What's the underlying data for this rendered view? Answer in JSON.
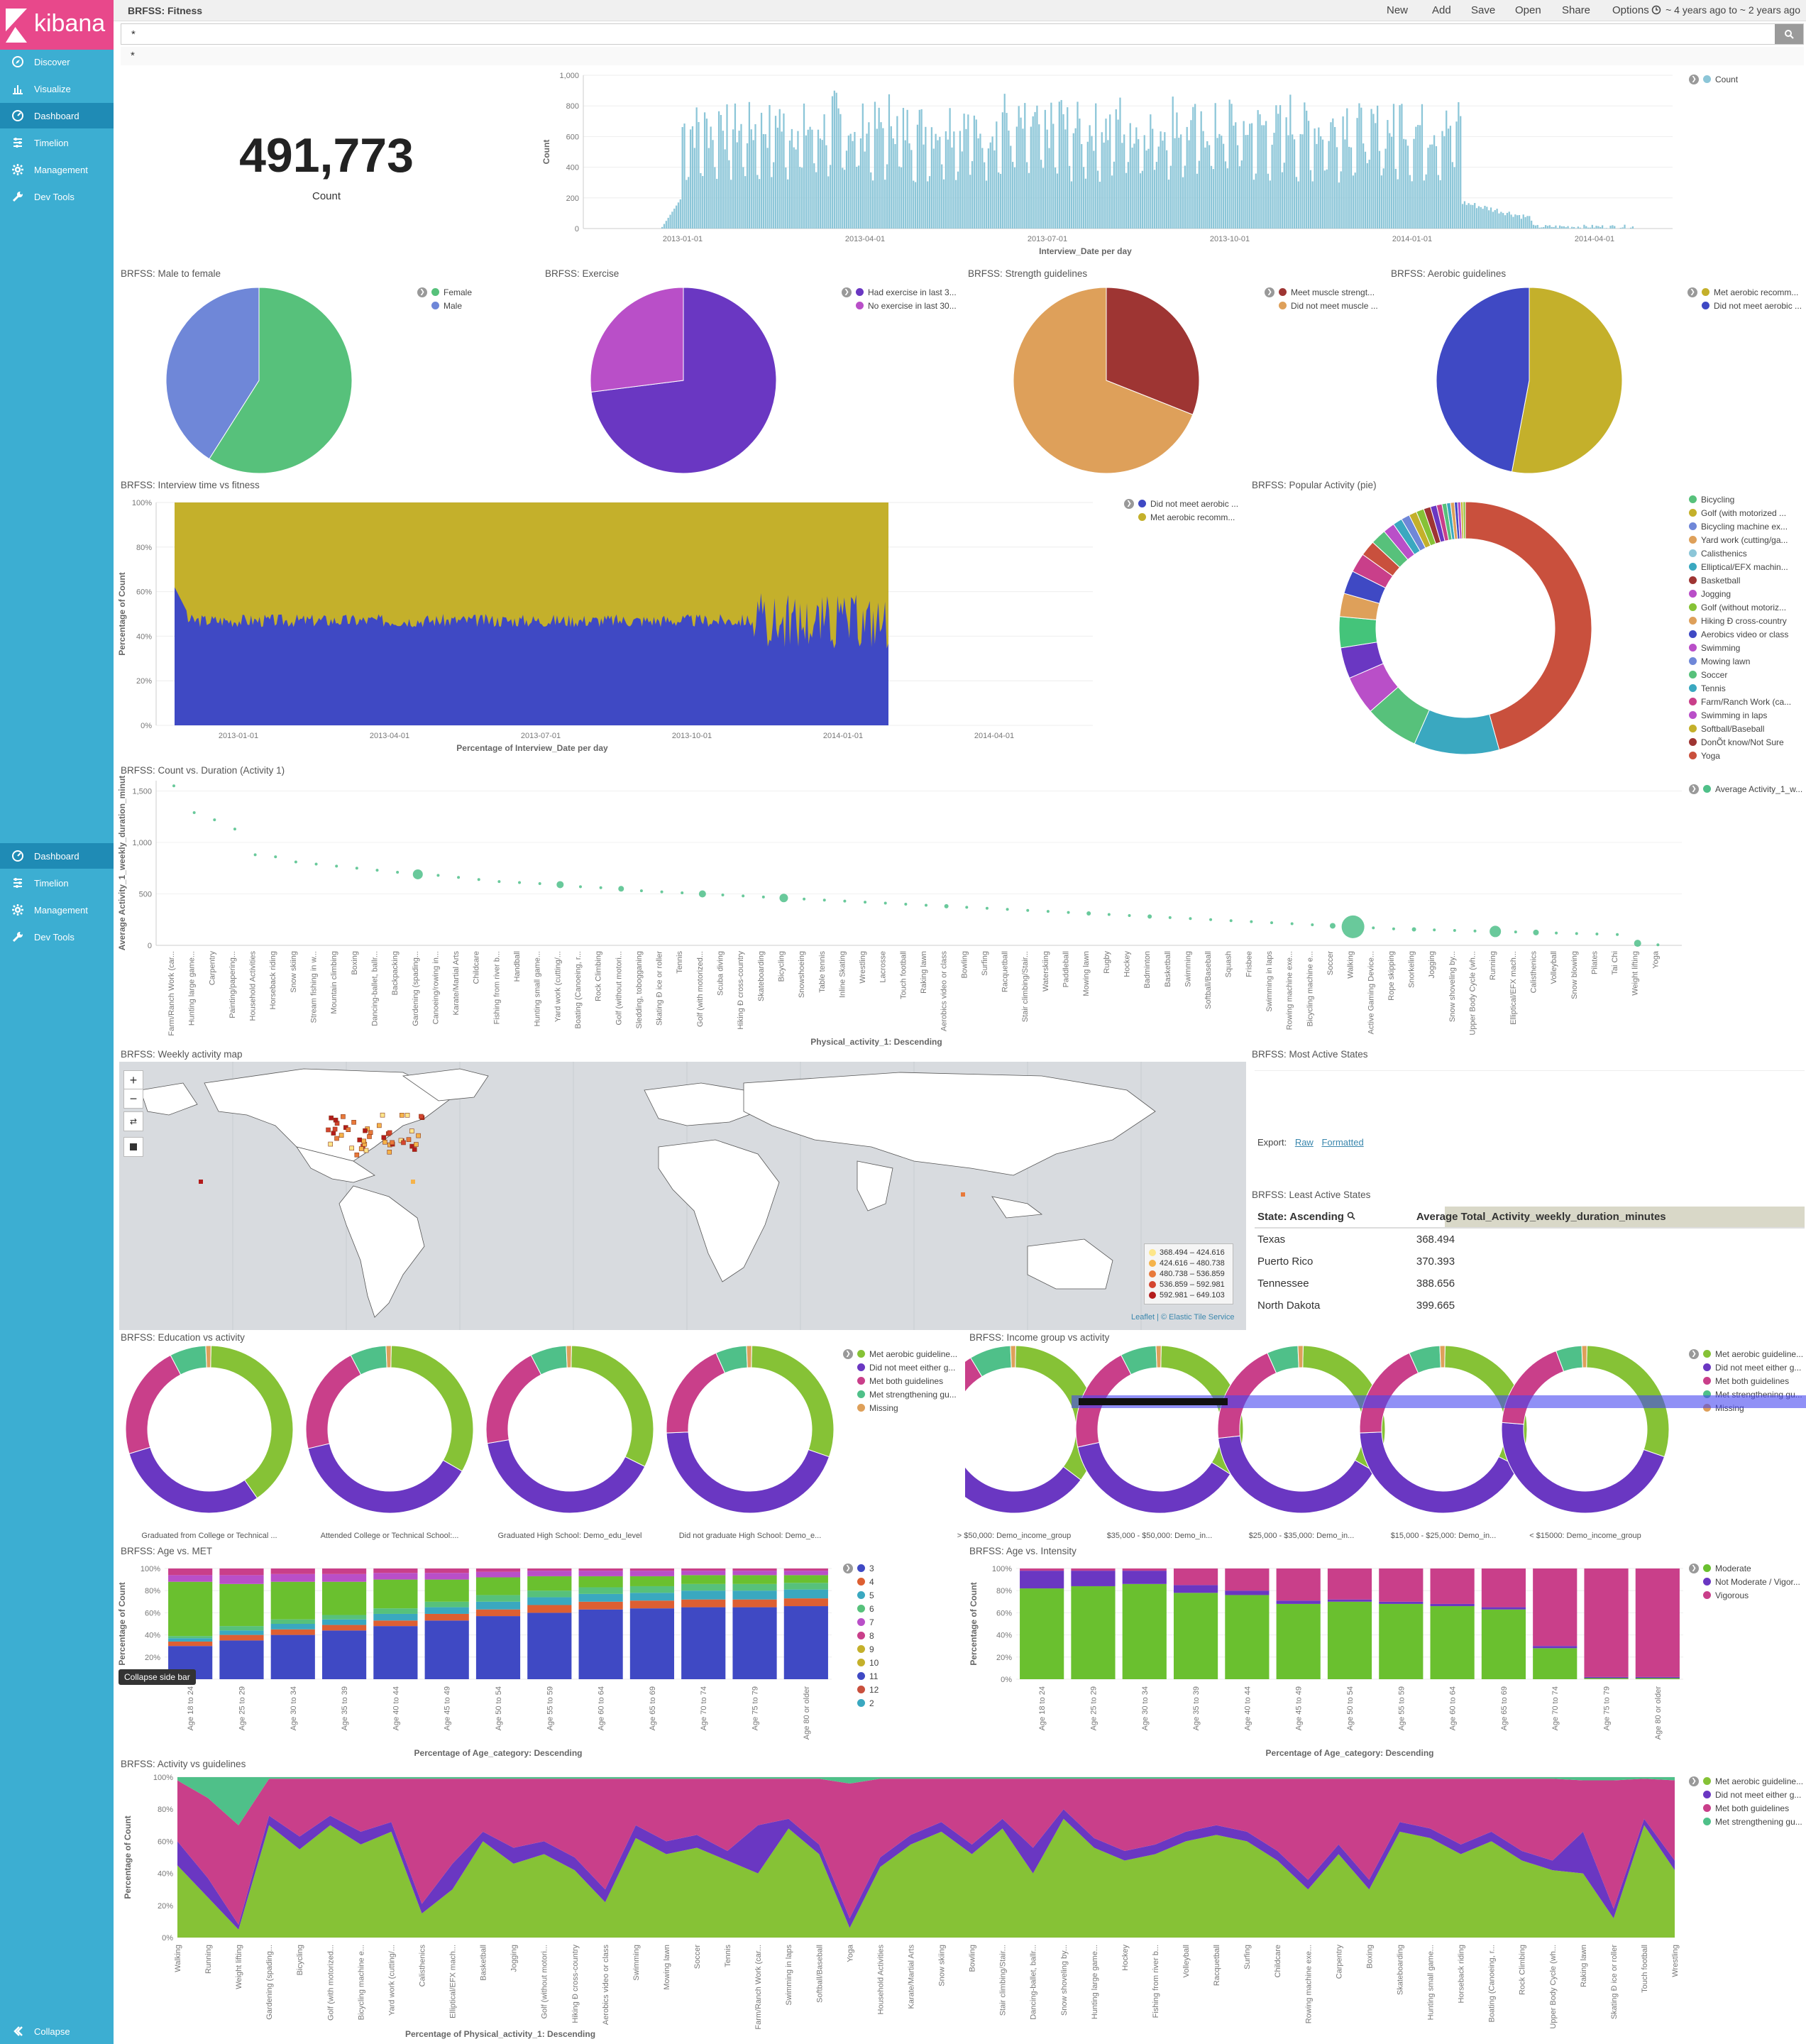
{
  "app": {
    "name": "kibana"
  },
  "nav": {
    "top": [
      {
        "label": "Discover",
        "icon": "compass-icon"
      },
      {
        "label": "Visualize",
        "icon": "bar-chart-icon"
      },
      {
        "label": "Dashboard",
        "icon": "dashboard-icon",
        "active": true
      },
      {
        "label": "Timelion",
        "icon": "timelion-icon"
      },
      {
        "label": "Management",
        "icon": "gear-icon"
      },
      {
        "label": "Dev Tools",
        "icon": "wrench-icon"
      }
    ],
    "repeat": [
      {
        "label": "Dashboard",
        "icon": "dashboard-icon",
        "active": true
      },
      {
        "label": "Timelion",
        "icon": "timelion-icon"
      },
      {
        "label": "Management",
        "icon": "gear-icon"
      },
      {
        "label": "Dev Tools",
        "icon": "wrench-icon"
      }
    ],
    "collapse": "Collapse",
    "collapse_tooltip": "Collapse side bar"
  },
  "topbar": {
    "title": "BRFSS: Fitness",
    "buttons": [
      "New",
      "Add",
      "Save",
      "Open",
      "Share",
      "Options"
    ],
    "time": "~ 4 years ago to ~ 2 years ago"
  },
  "query": {
    "value": "*",
    "filter": "*"
  },
  "metric": {
    "value": "491,773",
    "label": "Count"
  },
  "colors": {
    "teal": "#8cc6d8",
    "green": "#57c17b",
    "periwinkle": "#6f87d8",
    "purple": "#6a37c2",
    "magenta": "#b94fc8",
    "brown": "#9e3533",
    "orange": "#dea05a",
    "blue": "#3f49c4",
    "olive": "#c4b02b",
    "lime": "#86c236",
    "pink": "#c93f8a",
    "mint": "#4fc089",
    "red": "#c9503d",
    "cyan": "#3aa8c0"
  },
  "histogram": {
    "ylabel": "Count",
    "xlabel": "Interview_Date per day",
    "legend": "Count",
    "yticks": [
      "0",
      "200",
      "400",
      "600",
      "800",
      "1,000"
    ],
    "xticks": [
      "2013-01-01",
      "2013-04-01",
      "2013-07-01",
      "2013-10-01",
      "2014-01-01",
      "2014-04-01"
    ]
  },
  "pies": [
    {
      "title": "BRFSS: Male to female",
      "legend": [
        "Female",
        "Male"
      ],
      "colors": [
        "#57c17b",
        "#6f87d8"
      ],
      "values": [
        59,
        41
      ]
    },
    {
      "title": "BRFSS: Exercise",
      "legend": [
        "Had exercise in last 3...",
        "No exercise in last 30..."
      ],
      "colors": [
        "#6a37c2",
        "#b94fc8"
      ],
      "values": [
        73,
        27
      ]
    },
    {
      "title": "BRFSS: Strength guidelines",
      "legend": [
        "Meet muscle strengt...",
        "Did not meet muscle ..."
      ],
      "colors": [
        "#9e3533",
        "#dea05a"
      ],
      "values": [
        31,
        69
      ]
    },
    {
      "title": "BRFSS: Aerobic guidelines",
      "legend": [
        "Met aerobic recomm...",
        "Did not meet aerobic ..."
      ],
      "colors": [
        "#c4b02b",
        "#3f49c4"
      ],
      "values": [
        53,
        47
      ]
    }
  ],
  "interview": {
    "title": "BRFSS: Interview time vs fitness",
    "legend": [
      "Did not meet aerobic ...",
      "Met aerobic recomm..."
    ],
    "ylabel": "Percentage of Count",
    "xlabel": "Percentage of Interview_Date per day",
    "yticks": [
      "0%",
      "20%",
      "40%",
      "60%",
      "80%",
      "100%"
    ],
    "xticks": [
      "2013-01-01",
      "2013-04-01",
      "2013-07-01",
      "2013-10-01",
      "2014-01-01",
      "2014-04-01"
    ]
  },
  "popular": {
    "title": "BRFSS: Popular Activity (pie)",
    "legend": [
      "Bicycling",
      "Golf (with motorized ...",
      "Bicycling machine ex...",
      "Yard work (cutting/ga...",
      "Calisthenics",
      "Elliptical/EFX machin...",
      "Basketball",
      "Jogging",
      "Golf (without motoriz...",
      "Hiking Ð cross-country",
      "Aerobics video or class",
      "Swimming",
      "Mowing lawn",
      "Soccer",
      "Tennis",
      "Farm/Ranch Work (ca...",
      "Swimming in laps",
      "Softball/Baseball",
      "DonÕt know/Not Sure",
      "Yoga"
    ],
    "legend_colors": [
      "#57c17b",
      "#c4b02b",
      "#6f87d8",
      "#dea05a",
      "#8cc6d8",
      "#3aa8c0",
      "#9e3533",
      "#b94fc8",
      "#86c236",
      "#dea05a",
      "#3f49c4",
      "#b94fc8",
      "#6f87d8",
      "#57c17b",
      "#3aa8c0",
      "#c93f8a",
      "#b94fc8",
      "#c4b02b",
      "#9e3533",
      "#c9503d"
    ],
    "values": [
      46,
      11,
      7,
      5,
      4,
      4,
      3,
      3,
      2.5,
      2,
      2,
      1.5,
      1.2,
      1.1,
      1,
      1,
      0.9,
      0.8,
      0.7,
      0.6,
      0.5,
      0.5,
      0.4,
      0.4,
      0.3,
      0.3
    ],
    "colors": [
      "#c9503d",
      "#3aa8c0",
      "#57c17b",
      "#b94fc8",
      "#6a37c2",
      "#44c47a",
      "#dea05a",
      "#3f49c4",
      "#c93f8a",
      "#c9503d",
      "#57c17b",
      "#b94fc8",
      "#3aa8c0",
      "#6f87d8",
      "#c4b02b",
      "#86c236",
      "#9e3533",
      "#6a37c2",
      "#c93f8a",
      "#57c17b",
      "#3aa8c0",
      "#dea05a",
      "#3f49c4",
      "#b94fc8",
      "#c4b02b",
      "#86c236"
    ]
  },
  "scatter": {
    "title": "BRFSS: Count vs. Duration (Activity 1)",
    "legend": "Average Activity_1_w...",
    "ylabel": "Average Activity_1_weekly_duration_minut",
    "xlabel": "Physical_activity_1: Descending",
    "yticks": [
      "0",
      "500",
      "1,000",
      "1,500"
    ],
    "categories": [
      "Farm/Ranch Work (car...",
      "Hunting large game...",
      "Carpentry",
      "Painting/papering...",
      "Household Activities",
      "Horseback riding",
      "Snow skiing",
      "Stream fishing in w...",
      "Mountain climbing",
      "Boxing",
      "Dancing-ballet, ballr...",
      "Backpacking",
      "Gardening (spading...",
      "Canoeing/rowing in...",
      "Karate/Martial Arts",
      "Childcare",
      "Fishing from river b...",
      "Handball",
      "Hunting small game...",
      "Yard work (cutting/...",
      "Boating (Canoeing, r...",
      "Rock Climbing",
      "Golf (without motori...",
      "Sledding, tobogganing",
      "Skating Ð ice or roller",
      "Tennis",
      "Golf (with motorized...",
      "Scuba diving",
      "Hiking Ð cross-country",
      "Skateboarding",
      "Bicycling",
      "Snowshoeing",
      "Table tennis",
      "Inline Skating",
      "Wrestling",
      "Lacrosse",
      "Touch football",
      "Raking lawn",
      "Aerobics video or class",
      "Bowling",
      "Surfing",
      "Racquetball",
      "Stair climbing/Stair...",
      "Waterskiing",
      "Paddleball",
      "Mowing lawn",
      "Rugby",
      "Hockey",
      "Badminton",
      "Basketball",
      "Swimming",
      "Softball/Baseball",
      "Squash",
      "Frisbee",
      "Swimming in laps",
      "Rowing machine exe...",
      "Bicycling machine e...",
      "Soccer",
      "Walking",
      "Active Gaming Device...",
      "Rope skipping",
      "Snorkeling",
      "Jogging",
      "Snow shoveling by...",
      "Upper Body Cycle (wh...",
      "Running",
      "Elliptical/EFX mach...",
      "Calisthenics",
      "Volleyball",
      "Snow blowing",
      "Pilates",
      "Tai Chi",
      "Weight lifting",
      "Yoga"
    ],
    "values": [
      1550,
      1290,
      1220,
      1130,
      880,
      860,
      810,
      790,
      770,
      750,
      730,
      710,
      690,
      680,
      660,
      640,
      620,
      610,
      600,
      590,
      570,
      560,
      550,
      530,
      520,
      510,
      500,
      490,
      480,
      470,
      460,
      450,
      440,
      430,
      420,
      410,
      400,
      390,
      380,
      370,
      360,
      350,
      340,
      330,
      320,
      310,
      300,
      290,
      280,
      270,
      260,
      250,
      240,
      230,
      220,
      210,
      200,
      190,
      180,
      170,
      160,
      155,
      150,
      145,
      140,
      135,
      130,
      125,
      120,
      115,
      110,
      105,
      20,
      5
    ],
    "sizes": [
      2,
      2,
      2,
      2,
      2,
      2,
      2,
      2,
      2,
      2,
      2,
      2,
      7,
      2,
      2,
      2,
      2,
      2,
      2,
      5,
      2,
      2,
      4,
      2,
      2,
      2,
      5,
      2,
      2,
      2,
      6,
      2,
      2,
      2,
      2,
      2,
      2,
      2,
      3,
      2,
      2,
      2,
      2,
      2,
      2,
      3,
      2,
      2,
      3,
      2,
      2,
      2,
      2,
      2,
      2,
      2,
      2,
      4,
      16,
      2,
      2,
      3,
      2,
      2,
      2,
      8,
      2,
      4,
      2,
      2,
      2,
      2,
      5,
      2
    ]
  },
  "map": {
    "title": "BRFSS: Weekly activity map",
    "legend": [
      "368.494 – 424.616",
      "424.616 – 480.738",
      "480.738 – 536.859",
      "536.859 – 592.981",
      "592.981 – 649.103"
    ],
    "legend_colors": [
      "#fde68a",
      "#f5b34a",
      "#e8793a",
      "#d4452f",
      "#b31b1b"
    ],
    "attribution": "Leaflet | © Elastic Tile Service"
  },
  "most_active": {
    "title": "BRFSS: Most Active States",
    "export_label": "Export:",
    "raw": "Raw",
    "formatted": "Formatted"
  },
  "least_active": {
    "title": "BRFSS: Least Active States",
    "col1": "State: Ascending",
    "col2": "Average Total_Activity_weekly_duration_minutes",
    "rows": [
      [
        "Texas",
        "368.494"
      ],
      [
        "Puerto Rico",
        "370.393"
      ],
      [
        "Tennessee",
        "388.656"
      ],
      [
        "North Dakota",
        "399.665"
      ]
    ]
  },
  "education": {
    "title": "BRFSS: Education vs activity",
    "legend": [
      "Met aerobic guideline...",
      "Did not meet either g...",
      "Met both guidelines",
      "Met strengthening gu...",
      "Missing"
    ],
    "legend_colors": [
      "#86c236",
      "#6a37c2",
      "#c93f8a",
      "#4fc089",
      "#dea05a"
    ],
    "donuts": [
      {
        "label": "Graduated from College or Technical ...",
        "values": [
          40,
          30,
          22,
          7,
          1
        ]
      },
      {
        "label": "Attended College or Technical School:...",
        "values": [
          33,
          38,
          21,
          7,
          1
        ]
      },
      {
        "label": "Graduated High School: Demo_edu_level",
        "values": [
          32,
          40,
          20,
          7,
          1
        ]
      },
      {
        "label": "Did not graduate High School: Demo_e...",
        "values": [
          30,
          44,
          19,
          6,
          1
        ]
      }
    ]
  },
  "income": {
    "title": "BRFSS: Income group vs activity",
    "legend": [
      "Met aerobic guideline...",
      "Did not meet either g...",
      "Met both guidelines",
      "Met strengthening gu...",
      "Missing"
    ],
    "legend_colors": [
      "#86c236",
      "#6a37c2",
      "#c93f8a",
      "#4fc089",
      "#dea05a"
    ],
    "donuts": [
      {
        "label": "> $50,000: Demo_income_group",
        "values": [
          35,
          32,
          24,
          8,
          1
        ]
      },
      {
        "label": "$35,000 - $50,000: Demo_in...",
        "values": [
          34,
          38,
          21,
          7,
          1
        ]
      },
      {
        "label": "$25,000 - $35,000: Demo_in...",
        "values": [
          33,
          40,
          20,
          6,
          1
        ]
      },
      {
        "label": "$15,000 - $25,000: Demo_in...",
        "values": [
          32,
          42,
          19,
          6,
          1
        ]
      },
      {
        "label": "< $15000: Demo_income_group",
        "values": [
          30,
          46,
          18,
          5,
          1
        ]
      }
    ]
  },
  "age_met": {
    "title": "BRFSS: Age vs. MET",
    "ylabel": "Percentage of Count",
    "xlabel": "Percentage of Age_category: Descending",
    "yticks": [
      "0%",
      "20%",
      "40%",
      "60%",
      "80%",
      "100%"
    ],
    "categories": [
      "Age 18 to 24",
      "Age 25 to 29",
      "Age 30 to 34",
      "Age 35 to 39",
      "Age 40 to 44",
      "Age 45 to 49",
      "Age 50 to 54",
      "Age 55 to 59",
      "Age 60 to 64",
      "Age 65 to 69",
      "Age 70 to 74",
      "Age 75 to 79",
      "Age 80 or older"
    ],
    "legend": [
      "3",
      "4",
      "5",
      "6",
      "7",
      "8",
      "9",
      "10",
      "11",
      "12",
      "2"
    ],
    "legend_colors": [
      "#3f49c4",
      "#dd5f32",
      "#3aa8c0",
      "#57c17b",
      "#b94fc8",
      "#c93f8a",
      "#c4b02b",
      "#c4b02b",
      "#3f49c4",
      "#c9503d",
      "#3aa8c0"
    ],
    "series_colors": [
      "#3f49c4",
      "#dd5f32",
      "#3aa8c0",
      "#57c17b",
      "#6ac02f",
      "#b94fc8",
      "#c93f8a"
    ],
    "values": [
      [
        30,
        4,
        3,
        2,
        49,
        6,
        6
      ],
      [
        35,
        5,
        4,
        4,
        38,
        8,
        6
      ],
      [
        40,
        5,
        5,
        4,
        34,
        7,
        5
      ],
      [
        44,
        5,
        5,
        4,
        30,
        7,
        5
      ],
      [
        48,
        5,
        6,
        5,
        26,
        6,
        4
      ],
      [
        53,
        6,
        6,
        5,
        20,
        6,
        4
      ],
      [
        57,
        6,
        7,
        6,
        16,
        5,
        3
      ],
      [
        60,
        7,
        7,
        6,
        13,
        5,
        2
      ],
      [
        63,
        7,
        7,
        6,
        10,
        5,
        2
      ],
      [
        64,
        7,
        7,
        6,
        9,
        5,
        2
      ],
      [
        65,
        7,
        8,
        6,
        8,
        4,
        2
      ],
      [
        65,
        7,
        8,
        6,
        8,
        4,
        2
      ],
      [
        66,
        7,
        8,
        6,
        7,
        4,
        2
      ]
    ]
  },
  "age_intensity": {
    "title": "BRFSS: Age vs. Intensity",
    "ylabel": "Percentage of Count",
    "xlabel": "Percentage of Age_category: Descending",
    "yticks": [
      "0%",
      "20%",
      "40%",
      "60%",
      "80%",
      "100%"
    ],
    "categories": [
      "Age 18 to 24",
      "Age 25 to 29",
      "Age 30 to 34",
      "Age 35 to 39",
      "Age 40 to 44",
      "Age 45 to 49",
      "Age 50 to 54",
      "Age 55 to 59",
      "Age 60 to 64",
      "Age 65 to 69",
      "Age 70 to 74",
      "Age 75 to 79",
      "Age 80 or older"
    ],
    "legend": [
      "Moderate",
      "Not Moderate / Vigor...",
      "Vigorous"
    ],
    "legend_colors": [
      "#6ac02f",
      "#6a37c2",
      "#c93f8a"
    ],
    "values": [
      [
        82,
        16,
        2
      ],
      [
        84,
        14,
        2
      ],
      [
        86,
        12,
        2
      ],
      [
        78,
        7,
        15
      ],
      [
        76,
        4,
        20
      ],
      [
        68,
        3,
        29
      ],
      [
        70,
        2,
        28
      ],
      [
        68,
        2,
        30
      ],
      [
        66,
        2,
        32
      ],
      [
        63,
        2,
        35
      ],
      [
        28,
        2,
        70
      ],
      [
        1,
        1,
        98
      ],
      [
        1,
        1,
        98
      ]
    ]
  },
  "activity_guidelines": {
    "title": "BRFSS: Activity vs guidelines",
    "ylabel": "Percentage of Count",
    "xlabel": "Percentage of Physical_activity_1: Descending",
    "legend": [
      "Met aerobic guideline...",
      "Did not meet either g...",
      "Met both guidelines",
      "Met strengthening gu..."
    ],
    "legend_colors": [
      "#86c236",
      "#6a37c2",
      "#c93f8a",
      "#4fc089"
    ],
    "yticks": [
      "0%",
      "20%",
      "40%",
      "60%",
      "80%",
      "100%"
    ],
    "categories": [
      "Walking",
      "Running",
      "Weight lifting",
      "Gardening (spading...",
      "Bicycling",
      "Golf (with motorized...",
      "Bicycling machine e...",
      "Yard work (cutting/...",
      "Calisthenics",
      "Elliptical/EFX mach...",
      "Basketball",
      "Jogging",
      "Golf (without motori...",
      "Hiking Ð cross-country",
      "Aerobics video or class",
      "Swimming",
      "Mowing lawn",
      "Soccer",
      "Tennis",
      "Farm/Ranch Work (car...",
      "Swimming in laps",
      "Softball/Baseball",
      "Yoga",
      "Household Activities",
      "Karate/Martial Arts",
      "Snow skiing",
      "Bowling",
      "Stair climbing/Stair...",
      "Dancing-ballet, ballr...",
      "Snow shoveling by...",
      "Hunting large game...",
      "Hockey",
      "Fishing from river b...",
      "Volleyball",
      "Racquetball",
      "Surfing",
      "Childcare",
      "Rowing machine exe...",
      "Carpentry",
      "Boxing",
      "Skateboarding",
      "Hunting small game...",
      "Horseback riding",
      "Boating (Canoeing, r...",
      "Rock Climbing",
      "Upper Body Cycle (wh...",
      "Raking lawn",
      "Skating Ð ice or roller",
      "Touch football",
      "Wrestling"
    ],
    "met_aerobic": [
      45,
      25,
      5,
      70,
      55,
      70,
      58,
      66,
      15,
      30,
      60,
      46,
      52,
      42,
      22,
      62,
      52,
      56,
      48,
      40,
      68,
      52,
      6,
      44,
      58,
      66,
      52,
      68,
      40,
      74,
      56,
      48,
      52,
      60,
      64,
      60,
      48,
      30,
      52,
      30,
      66,
      62,
      52,
      60,
      48,
      42,
      40,
      12,
      70,
      42
    ],
    "not_meet": [
      15,
      12,
      3,
      6,
      8,
      6,
      8,
      6,
      6,
      16,
      6,
      10,
      8,
      8,
      8,
      8,
      8,
      8,
      6,
      30,
      6,
      6,
      6,
      6,
      6,
      6,
      6,
      6,
      16,
      6,
      6,
      6,
      6,
      6,
      6,
      6,
      6,
      6,
      6,
      6,
      6,
      6,
      6,
      6,
      6,
      6,
      26,
      6,
      4,
      6
    ],
    "met_both": [
      38,
      50,
      62,
      23,
      36,
      23,
      33,
      27,
      78,
      53,
      33,
      43,
      39,
      49,
      69,
      29,
      39,
      35,
      45,
      29,
      25,
      41,
      84,
      49,
      35,
      27,
      41,
      25,
      43,
      19,
      37,
      45,
      41,
      33,
      29,
      33,
      45,
      63,
      41,
      63,
      27,
      31,
      41,
      33,
      45,
      51,
      32,
      80,
      25,
      50
    ],
    "met_strength": [
      2,
      13,
      30,
      1,
      1,
      1,
      1,
      1,
      1,
      1,
      1,
      1,
      1,
      1,
      1,
      1,
      1,
      1,
      1,
      1,
      1,
      1,
      4,
      1,
      1,
      1,
      1,
      1,
      1,
      1,
      1,
      1,
      1,
      1,
      1,
      1,
      1,
      1,
      1,
      1,
      1,
      1,
      1,
      1,
      1,
      1,
      2,
      2,
      1,
      2
    ]
  }
}
